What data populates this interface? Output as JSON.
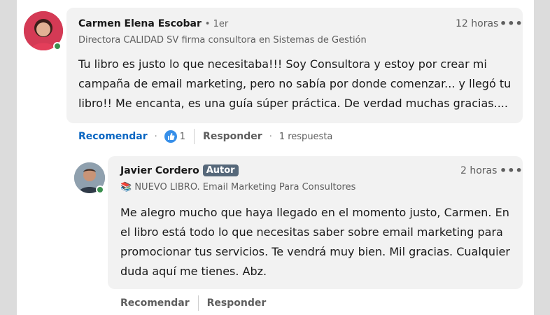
{
  "comment": {
    "author": "Carmen Elena Escobar",
    "degree": "• 1er",
    "headline": "Directora CALIDAD SV firma consultora en Sistemas de Gestión",
    "time": "12 horas",
    "more": "•••",
    "text": "Tu libro es justo lo que necesitaba!!! Soy Consultora y estoy por crear mi campaña de email marketing, pero no sabía por donde comenzar... y llegó tu libro!! Me encanta, es una guía súper práctica. De verdad muchas gracias....",
    "actions": {
      "like": "Recomendar",
      "dot1": "·",
      "reactions_count": "1",
      "reply": "Responder",
      "dot2": "·",
      "replies": "1 respuesta"
    },
    "reaction_icon": "thumbs-up-icon",
    "avatar_color": "#c8354a"
  },
  "reply": {
    "author": "Javier Cordero",
    "badge": "Autor",
    "headline_emoji": "📚",
    "headline": "NUEVO LIBRO. Email Marketing Para Consultores",
    "time": "2 horas",
    "more": "•••",
    "text": "Me alegro mucho que haya llegado en el momento justo, Carmen. En el libro está todo lo que necesitas saber sobre email marketing para promocionar tus servicios. Te vendrá muy bien. Mil gracias. Cualquier duda aquí me tienes. Abz.",
    "actions": {
      "like": "Recomendar",
      "reply": "Responder"
    },
    "avatar_color": "#6b7d8c"
  },
  "colors": {
    "link_blue": "#0a66c2",
    "online_green": "#3a8f4e",
    "badge_bg": "#56687a",
    "bubble_bg": "#f2f2f2"
  }
}
